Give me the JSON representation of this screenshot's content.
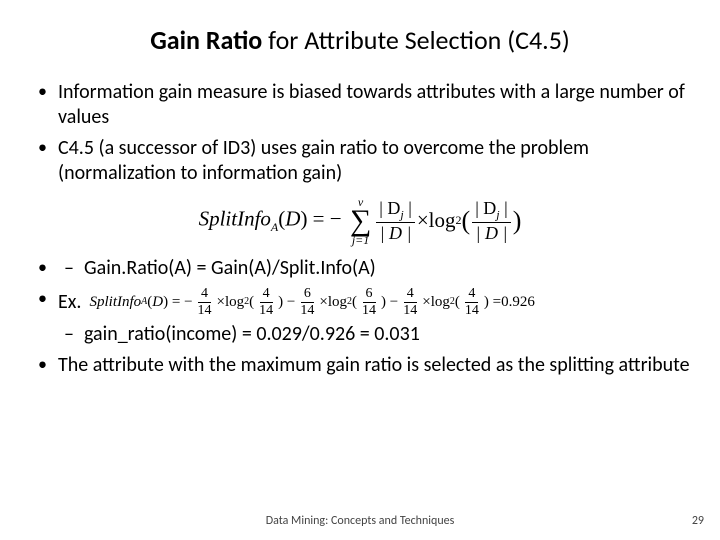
{
  "title": {
    "bold": "Gain Ratio",
    "rest": " for Attribute Selection (C4.5)"
  },
  "bullets": {
    "b1": "Information gain measure is biased towards attributes with a large number of values",
    "b2": "C4.5 (a successor of ID3) uses gain ratio to overcome the problem (normalization to information gain)",
    "b3_sub": "Gain.Ratio(A) = Gain(A)/Split.Info(A)",
    "b4_label": "Ex.",
    "b4_sub": "gain_ratio(income) = 0.029/0.926 = 0.031",
    "b5": "The attribute with the maximum gain ratio is selected as the splitting attribute"
  },
  "formula1": {
    "lhs_name": "SplitInfo",
    "lhs_sub": "A",
    "lhs_arg": "D",
    "sum_top": "v",
    "sum_bot": "j=1",
    "frac_num": "| D",
    "frac_num_sub": "j",
    "frac_num_end": " |",
    "frac_den": "| D |",
    "log": "log",
    "log_sub": "2"
  },
  "formula2": {
    "lhs_name": "SplitInfo",
    "lhs_sub": "A",
    "lhs_arg": "D",
    "terms": [
      {
        "num": "4",
        "den": "14"
      },
      {
        "num": "6",
        "den": "14"
      },
      {
        "num": "4",
        "den": "14"
      }
    ],
    "log": "log",
    "log_sub": "2",
    "result": "0.926"
  },
  "footer": "Data Mining: Concepts and Techniques",
  "page": "29"
}
